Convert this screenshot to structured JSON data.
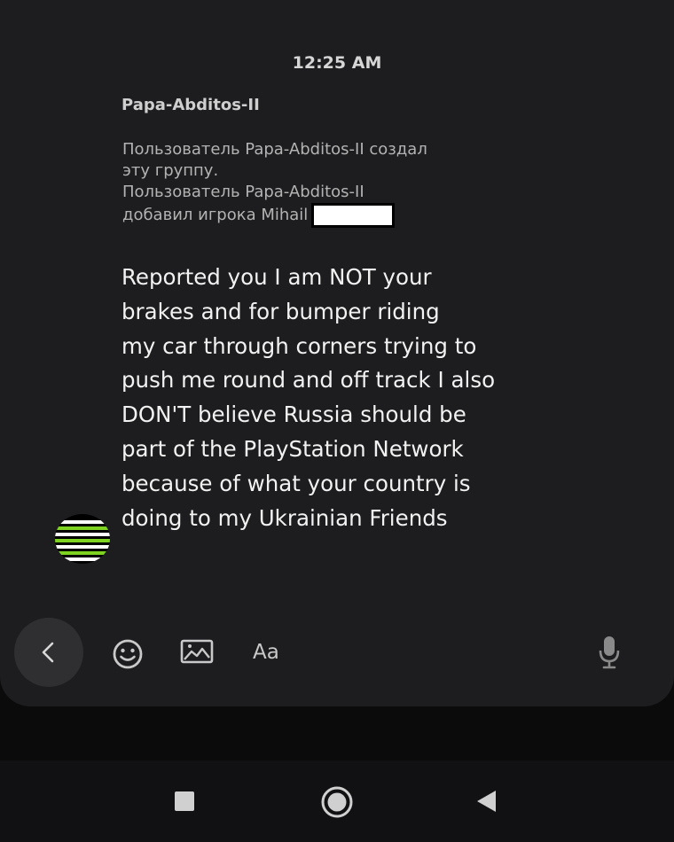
{
  "chat": {
    "timestamp": "12:25 AM",
    "sender_name": "Papa-Abditos-II",
    "system_message": {
      "lines": [
        "Пользователь Papa-Abditos-II создал",
        "эту группу.",
        "Пользователь Papa-Abditos-II",
        "добавил игрока Mihail"
      ]
    },
    "message": {
      "lines": [
        "Reported you I am NOT your",
        "brakes and for bumper riding",
        "my car through corners trying to",
        "push me round and off track I also",
        "DON'T believe Russia should be",
        "part of the PlayStation Network",
        "because of what your country is",
        "doing to my Ukrainian Friends"
      ]
    },
    "avatar": {
      "stripe_colors": [
        "#ffffff",
        "#7ed321"
      ]
    }
  },
  "toolbar": {
    "back_icon": "chevron-left-icon",
    "emoji_icon": "emoji-icon",
    "image_icon": "image-icon",
    "text_format_label": "Aa",
    "mic_icon": "microphone-icon"
  },
  "navigation": {
    "recents_icon": "square-icon",
    "home_icon": "circle-icon",
    "back_icon": "triangle-back-icon"
  },
  "colors": {
    "panel": "#1d1d1f",
    "background": "#0b0b0c",
    "accent_green": "#7ed321"
  }
}
